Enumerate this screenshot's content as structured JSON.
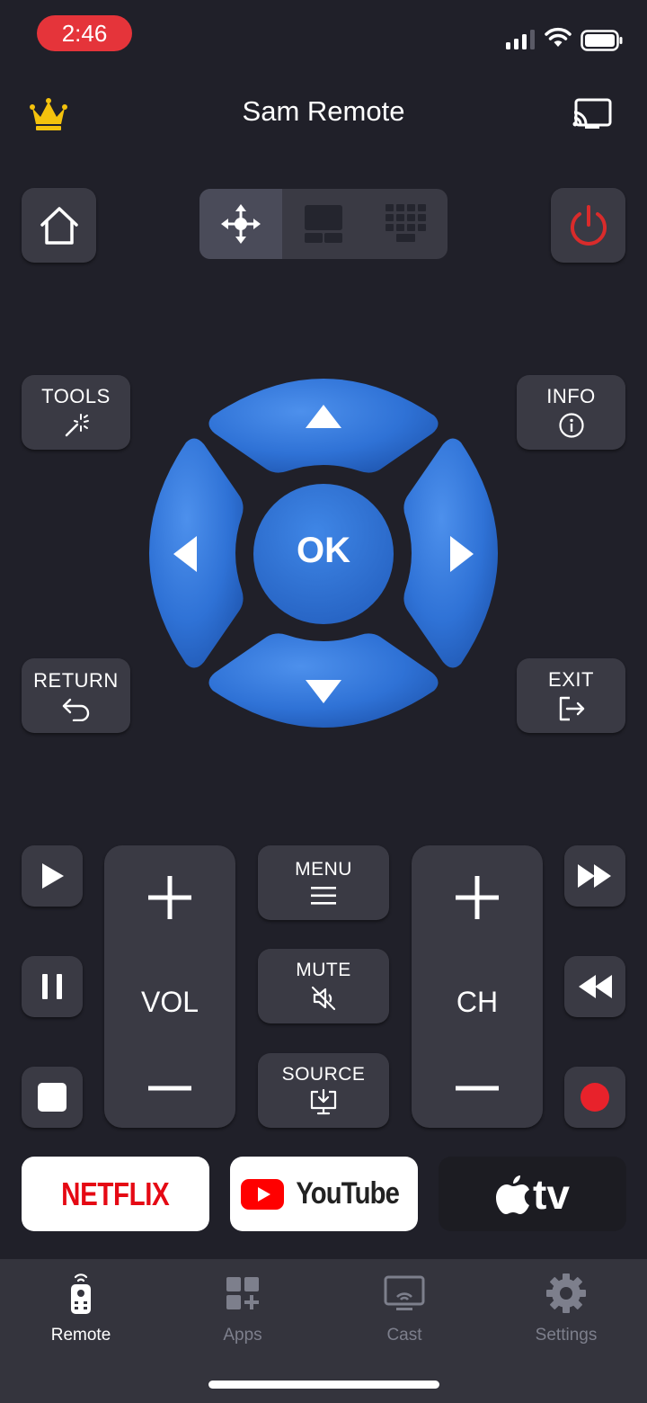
{
  "status_bar": {
    "time": "2:46"
  },
  "header": {
    "title": "Sam Remote"
  },
  "buttons": {
    "tools": "TOOLS",
    "info": "INFO",
    "return": "RETURN",
    "exit": "EXIT",
    "ok": "OK",
    "menu": "MENU",
    "mute": "MUTE",
    "source": "SOURCE",
    "vol": "VOL",
    "ch": "CH"
  },
  "apps": {
    "netflix": "NETFLIX",
    "youtube": "YouTube",
    "appletv": "tv"
  },
  "tabs": [
    {
      "label": "Remote",
      "active": true
    },
    {
      "label": "Apps",
      "active": false
    },
    {
      "label": "Cast",
      "active": false
    },
    {
      "label": "Settings",
      "active": false
    }
  ],
  "colors": {
    "background": "#202029",
    "button": "#3a3a44",
    "dpad_blue": "#2f72d6",
    "power_red": "#d92b2b",
    "record_red": "#e8222b",
    "crown_gold": "#f4c20d",
    "netflix_red": "#e50914",
    "youtube_red": "#ff0000"
  },
  "icons": {
    "premium": "crown-icon",
    "cast": "cast-icon",
    "home": "home-icon",
    "power": "power-icon"
  }
}
